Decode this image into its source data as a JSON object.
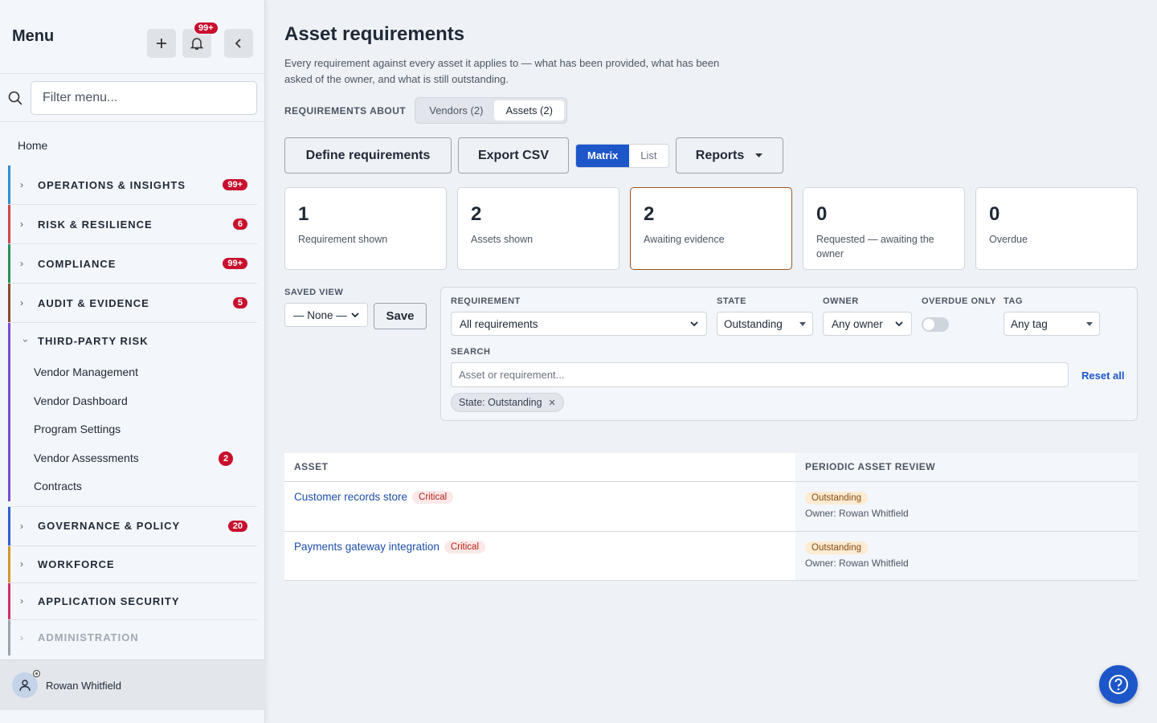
{
  "sidebar": {
    "title": "Menu",
    "notif_badge": "99+",
    "filter_placeholder": "Filter menu...",
    "home": "Home",
    "sections": [
      {
        "label": "OPERATIONS & INSIGHTS",
        "count": "99+",
        "color": "#2f8fd1"
      },
      {
        "label": "RISK & RESILIENCE",
        "count": "6",
        "color": "#d14646"
      },
      {
        "label": "COMPLIANCE",
        "count": "99+",
        "color": "#2a8f57"
      },
      {
        "label": "AUDIT & EVIDENCE",
        "count": "5",
        "color": "#8a4b2a"
      },
      {
        "label": "THIRD-PARTY RISK",
        "color": "#7a4bd1"
      },
      {
        "label": "GOVERNANCE & POLICY",
        "count": "20",
        "color": "#2f5fd1"
      },
      {
        "label": "WORKFORCE",
        "color": "#d1952f"
      },
      {
        "label": "APPLICATION SECURITY",
        "color": "#d12f6a"
      },
      {
        "label": "ADMINISTRATION",
        "color": "#9aa3ad"
      }
    ],
    "tpr_items": [
      {
        "label": "Vendor Management"
      },
      {
        "label": "Vendor Dashboard"
      },
      {
        "label": "Program Settings"
      },
      {
        "label": "Vendor Assessments",
        "count": "2"
      },
      {
        "label": "Contracts"
      }
    ],
    "user": "Rowan Whitfield"
  },
  "page": {
    "title": "Asset requirements",
    "description": "Every requirement against every asset it applies to — what has been provided, what has been asked of the owner, and what is still outstanding.",
    "about_label": "REQUIREMENTS ABOUT",
    "about_tabs": [
      "Vendors (2)",
      "Assets (2)"
    ],
    "actions": {
      "define": "Define requirements",
      "export": "Export CSV",
      "view_matrix": "Matrix",
      "view_list": "List",
      "reports": "Reports"
    },
    "stats": [
      {
        "value": "1",
        "label": "Requirement shown"
      },
      {
        "value": "2",
        "label": "Assets shown"
      },
      {
        "value": "2",
        "label": "Awaiting evidence"
      },
      {
        "value": "0",
        "label": "Requested — awaiting the owner"
      },
      {
        "value": "0",
        "label": "Overdue"
      }
    ],
    "saved_view": {
      "label": "SAVED VIEW",
      "value": "— None —",
      "save": "Save"
    },
    "filters": {
      "requirement_label": "REQUIREMENT",
      "requirement_value": "All requirements",
      "state_label": "STATE",
      "state_value": "Outstanding",
      "owner_label": "OWNER",
      "owner_value": "Any owner",
      "overdue_label": "OVERDUE ONLY",
      "tag_label": "TAG",
      "tag_value": "Any tag",
      "search_label": "SEARCH",
      "search_placeholder": "Asset or requirement...",
      "reset": "Reset all",
      "chip": "State: Outstanding"
    },
    "table": {
      "headers": [
        "ASSET",
        "PERIODIC ASSET REVIEW"
      ],
      "rows": [
        {
          "asset": "Customer records store",
          "tag": "Critical",
          "status": "Outstanding",
          "owner": "Owner: Rowan Whitfield"
        },
        {
          "asset": "Payments gateway integration",
          "tag": "Critical",
          "status": "Outstanding",
          "owner": "Owner: Rowan Whitfield"
        }
      ]
    }
  }
}
